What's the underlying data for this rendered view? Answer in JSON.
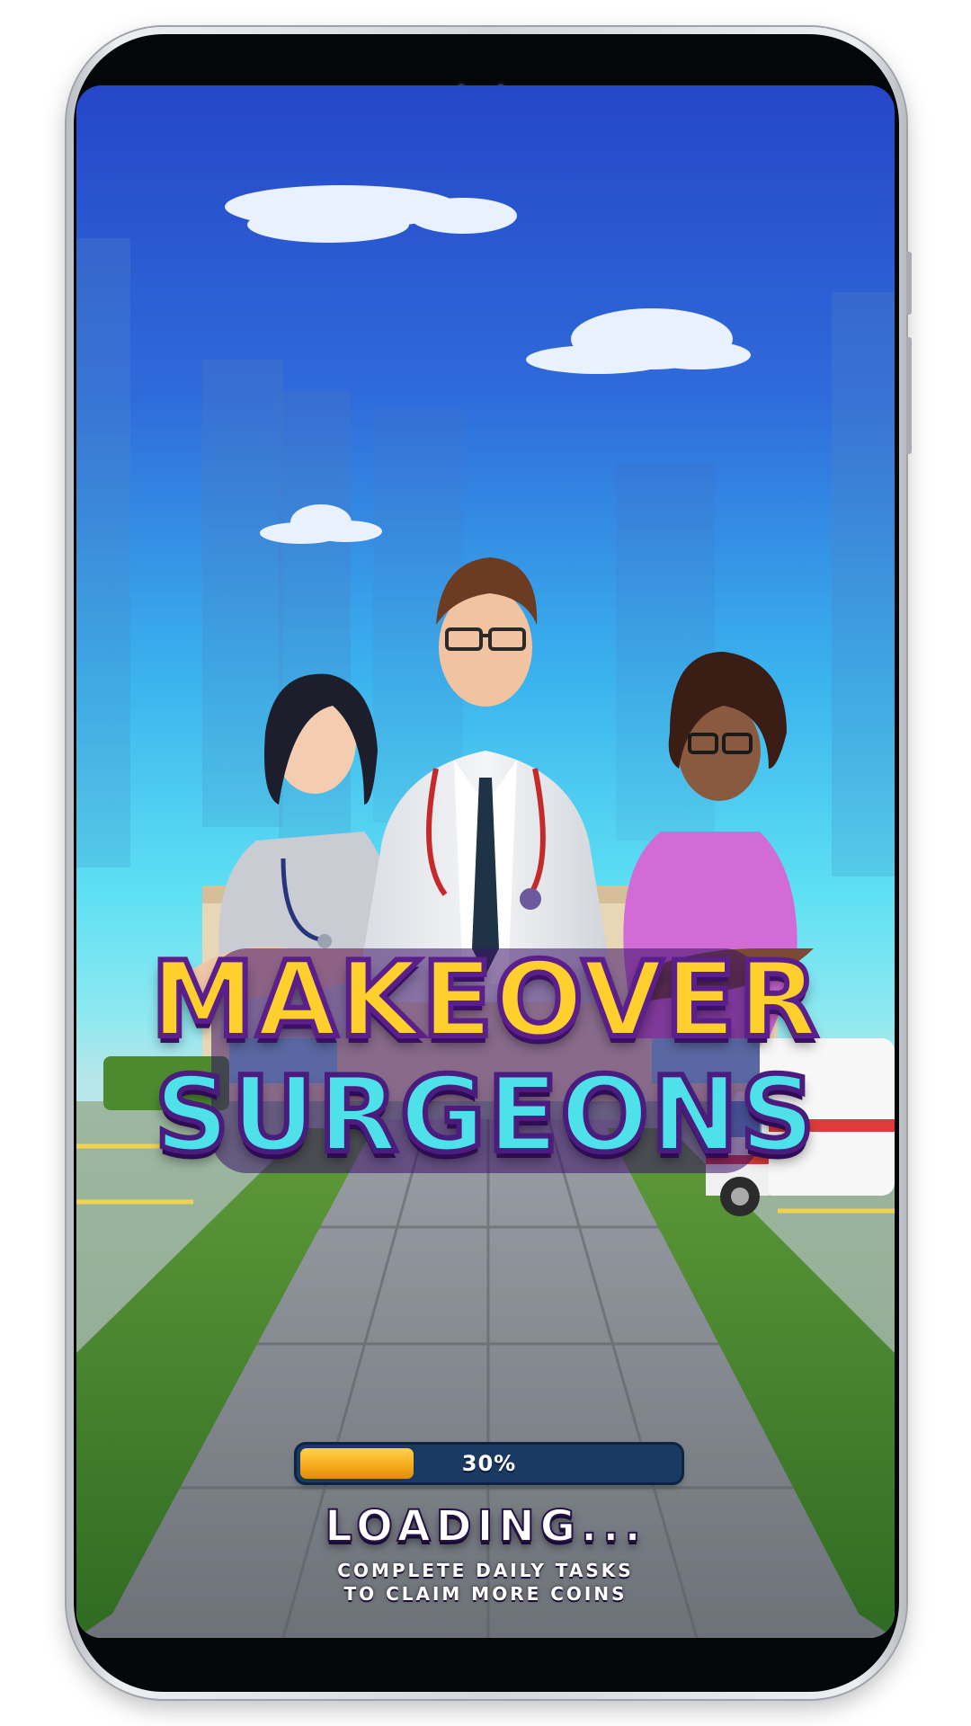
{
  "game": {
    "title_line_1": "MAKEOVER",
    "title_line_2": "SURGEONS"
  },
  "loading": {
    "progress_percent": 30,
    "progress_label": "30%",
    "status_text": "LOADING...",
    "tip_line_1": "COMPLETE DAILY TASKS",
    "tip_line_2": "TO CLAIM MORE COINS"
  },
  "colors": {
    "sky_top": "#2546c8",
    "sky_bottom": "#5ee0f3",
    "title_primary": "#ffcf2e",
    "title_secondary": "#4fe1ea",
    "title_outline": "#5a1f8a",
    "progress_fill": "#f4a91a",
    "progress_track": "#1b3a63"
  }
}
